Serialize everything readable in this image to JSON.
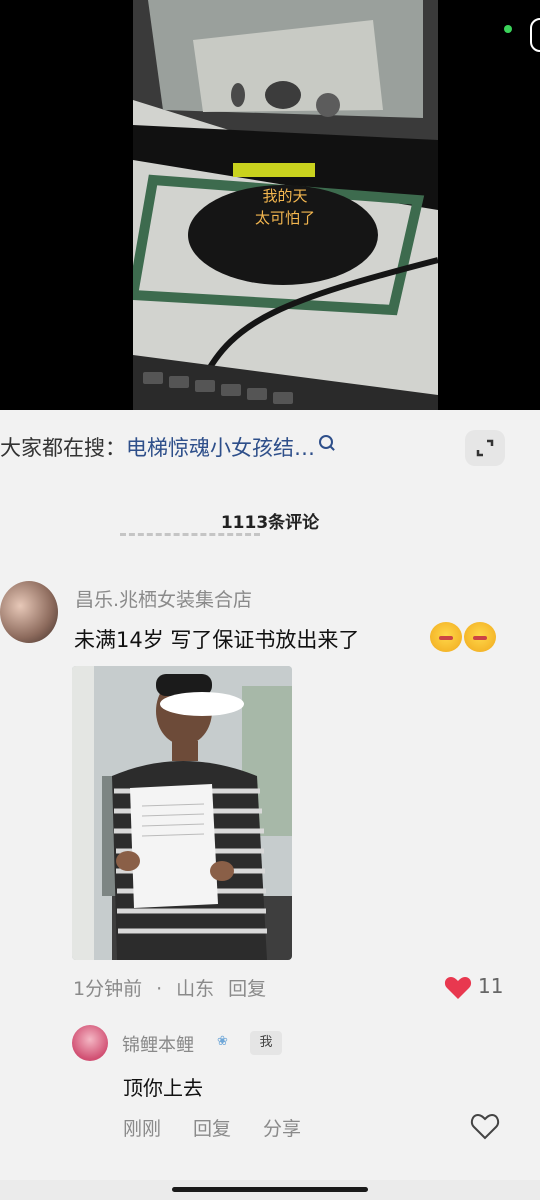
{
  "video": {
    "subtitle_line1": "我的天",
    "subtitle_line2": "太可怕了"
  },
  "search": {
    "prefix": "大家都在搜：",
    "query": "电梯惊魂小女孩结…"
  },
  "comments_header": "1113条评论",
  "comment1": {
    "username": "昌乐.兆栖女装集合店",
    "text": "未满14岁 写了保证书放出来了",
    "time": "1分钟前",
    "dot": "·",
    "location": "山东",
    "reply": "回复",
    "likes": "11"
  },
  "comment2": {
    "username": "锦鲤本鲤",
    "badge": "我",
    "text": "顶你上去",
    "time": "刚刚",
    "reply": "回复",
    "share": "分享"
  },
  "colors": {
    "like_red": "#e8384f",
    "link_blue": "#2e4f8a"
  }
}
